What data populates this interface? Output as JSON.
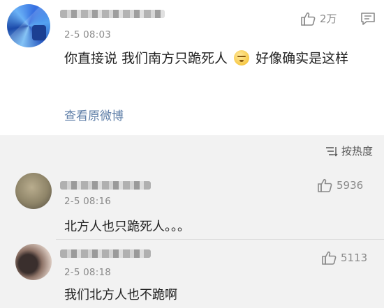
{
  "main_comment": {
    "timestamp": "2-5 08:03",
    "like_count": "2万",
    "text_before_emoji": "你直接说 我们南方只跪死人",
    "text_after_emoji": "好像确实是这样",
    "view_original_label": "查看原微博"
  },
  "replies_header": {
    "sort_label": "按热度"
  },
  "replies": [
    {
      "timestamp": "2-5 08:16",
      "like_count": "5936",
      "text": "北方人也只跪死人。。。"
    },
    {
      "timestamp": "2-5 08:18",
      "like_count": "5113",
      "text": "我们北方人也不跪啊"
    }
  ],
  "colors": {
    "background": "#f2f2f2",
    "card": "#ffffff",
    "link": "#5f7fa8",
    "muted": "#8a8a8a"
  },
  "icons": [
    "thumbs-up-icon",
    "comment-icon",
    "sort-icon",
    "emoji-icon"
  ]
}
